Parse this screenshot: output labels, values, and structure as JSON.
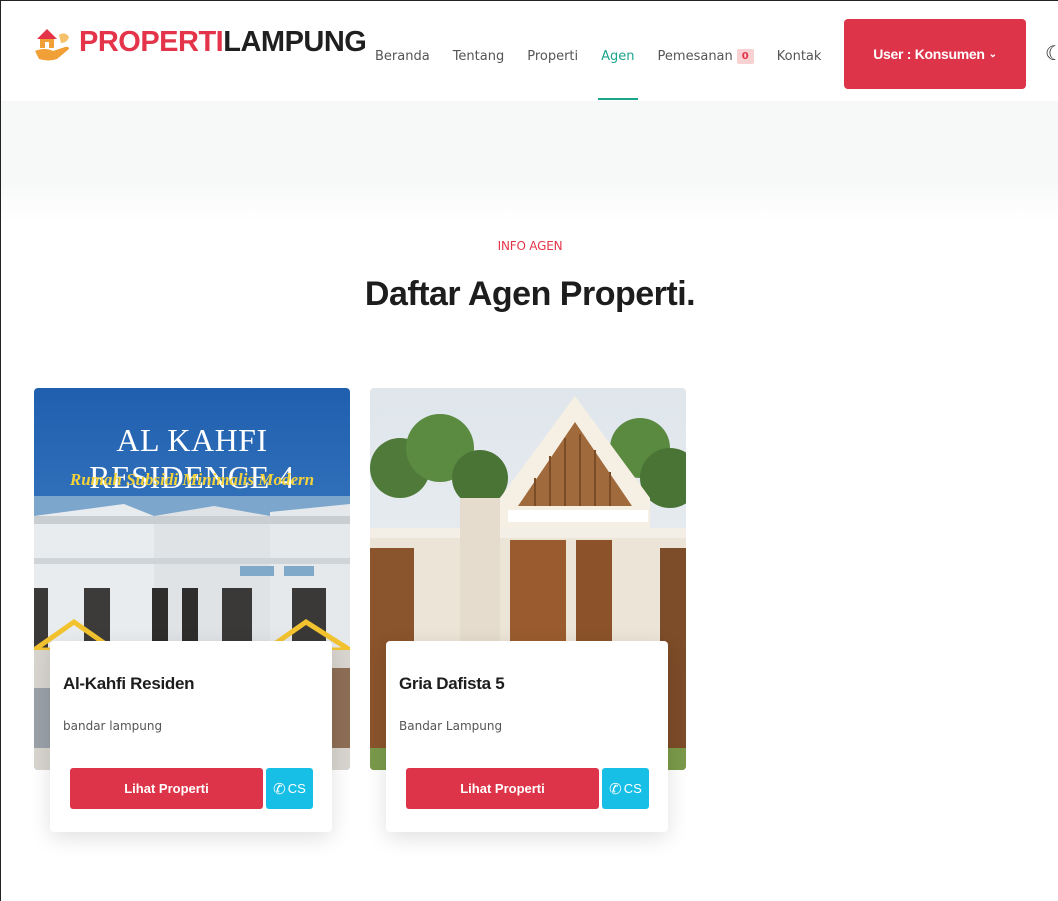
{
  "brand": {
    "part1": "PROPERTI",
    "part2": "LAMPUNG"
  },
  "nav": {
    "items": [
      {
        "label": "Beranda"
      },
      {
        "label": "Tentang"
      },
      {
        "label": "Properti"
      },
      {
        "label": "Agen"
      },
      {
        "label": "Pemesanan",
        "badge": "0"
      },
      {
        "label": "Kontak"
      }
    ],
    "active": "Agen"
  },
  "user_menu": {
    "label": "User : Konsumen",
    "chevron": "⌄"
  },
  "theme_toggle": {
    "icon": "moon-icon",
    "glyph": "☾"
  },
  "section": {
    "subtitle": "INFO AGEN",
    "title": "Daftar Agen Properti."
  },
  "agents": [
    {
      "name": "Al-Kahfi Residen",
      "location": "bandar lampung",
      "image_title": "AL KAHFI RESIDENCE 4",
      "image_tagline": "Rumah Subsidi Minimalis Modern",
      "view_label": "Lihat Properti",
      "cs_label": "CS"
    },
    {
      "name": "Gria Dafista 5",
      "location": "Bandar Lampung",
      "view_label": "Lihat Properti",
      "cs_label": "CS"
    }
  ],
  "colors": {
    "accent": "#dd3449",
    "active_nav": "#1aa58d",
    "cs_button": "#17bfe6"
  }
}
